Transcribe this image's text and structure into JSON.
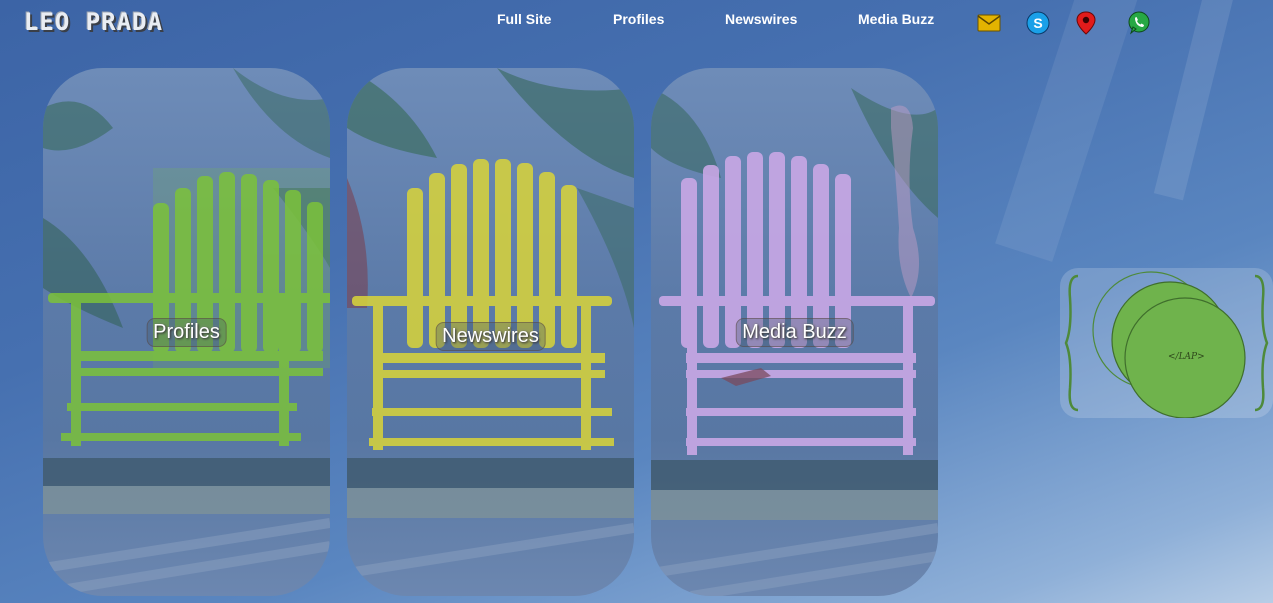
{
  "header": {
    "logo": "LEO PRADA",
    "nav": [
      {
        "label": "Full Site"
      },
      {
        "label": "Profiles"
      },
      {
        "label": "Newswires"
      },
      {
        "label": "Media Buzz"
      }
    ],
    "icons": [
      "mail-icon",
      "skype-icon",
      "location-pin-icon",
      "whatsapp-icon"
    ]
  },
  "cards": [
    {
      "label": "Profiles",
      "chair_color": "#7cc23a"
    },
    {
      "label": "Newswires",
      "chair_color": "#d6d23c"
    },
    {
      "label": "Media Buzz",
      "chair_color": "#c9a8e6"
    }
  ],
  "badge": {
    "text": "</LAP>"
  },
  "colors": {
    "background": "#4670b0",
    "mail": "#e3b300",
    "skype": "#1aa0e8",
    "pin": "#e21b1b",
    "whatsapp": "#27a844",
    "badge_green": "#6fb34c"
  }
}
